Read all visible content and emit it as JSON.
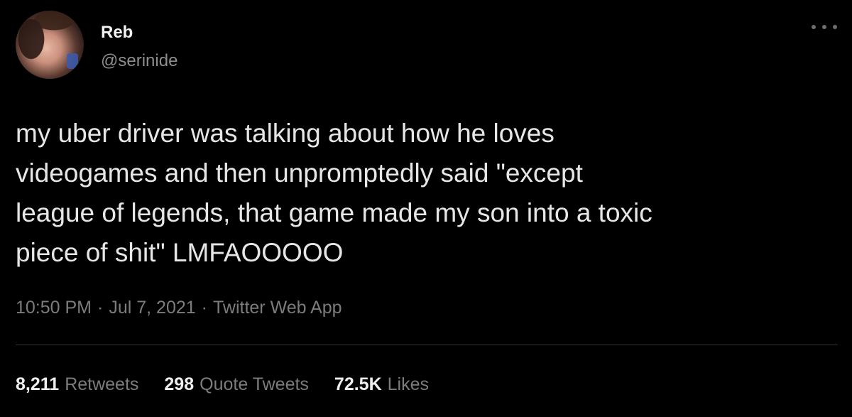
{
  "author": {
    "name": "Reb",
    "handle": "@serinide"
  },
  "tweet": {
    "text": "my uber driver was talking about how he loves\nvideogames and then unpromptedly said \"except\nleague of legends, that game made my son into a toxic\npiece of shit\" LMFAOOOOO",
    "time": "10:50 PM",
    "date": "Jul 7, 2021",
    "source": "Twitter Web App",
    "separator": "·"
  },
  "stats": {
    "retweets_count": "8,211",
    "retweets_label": "Retweets",
    "quotes_count": "298",
    "quotes_label": "Quote Tweets",
    "likes_count": "72.5K",
    "likes_label": "Likes"
  },
  "icons": {
    "more": "more-options-icon"
  },
  "colors": {
    "background": "#000000",
    "text_primary": "#e6e6e6",
    "text_secondary": "#7c7c7c",
    "divider": "#2f3336"
  }
}
